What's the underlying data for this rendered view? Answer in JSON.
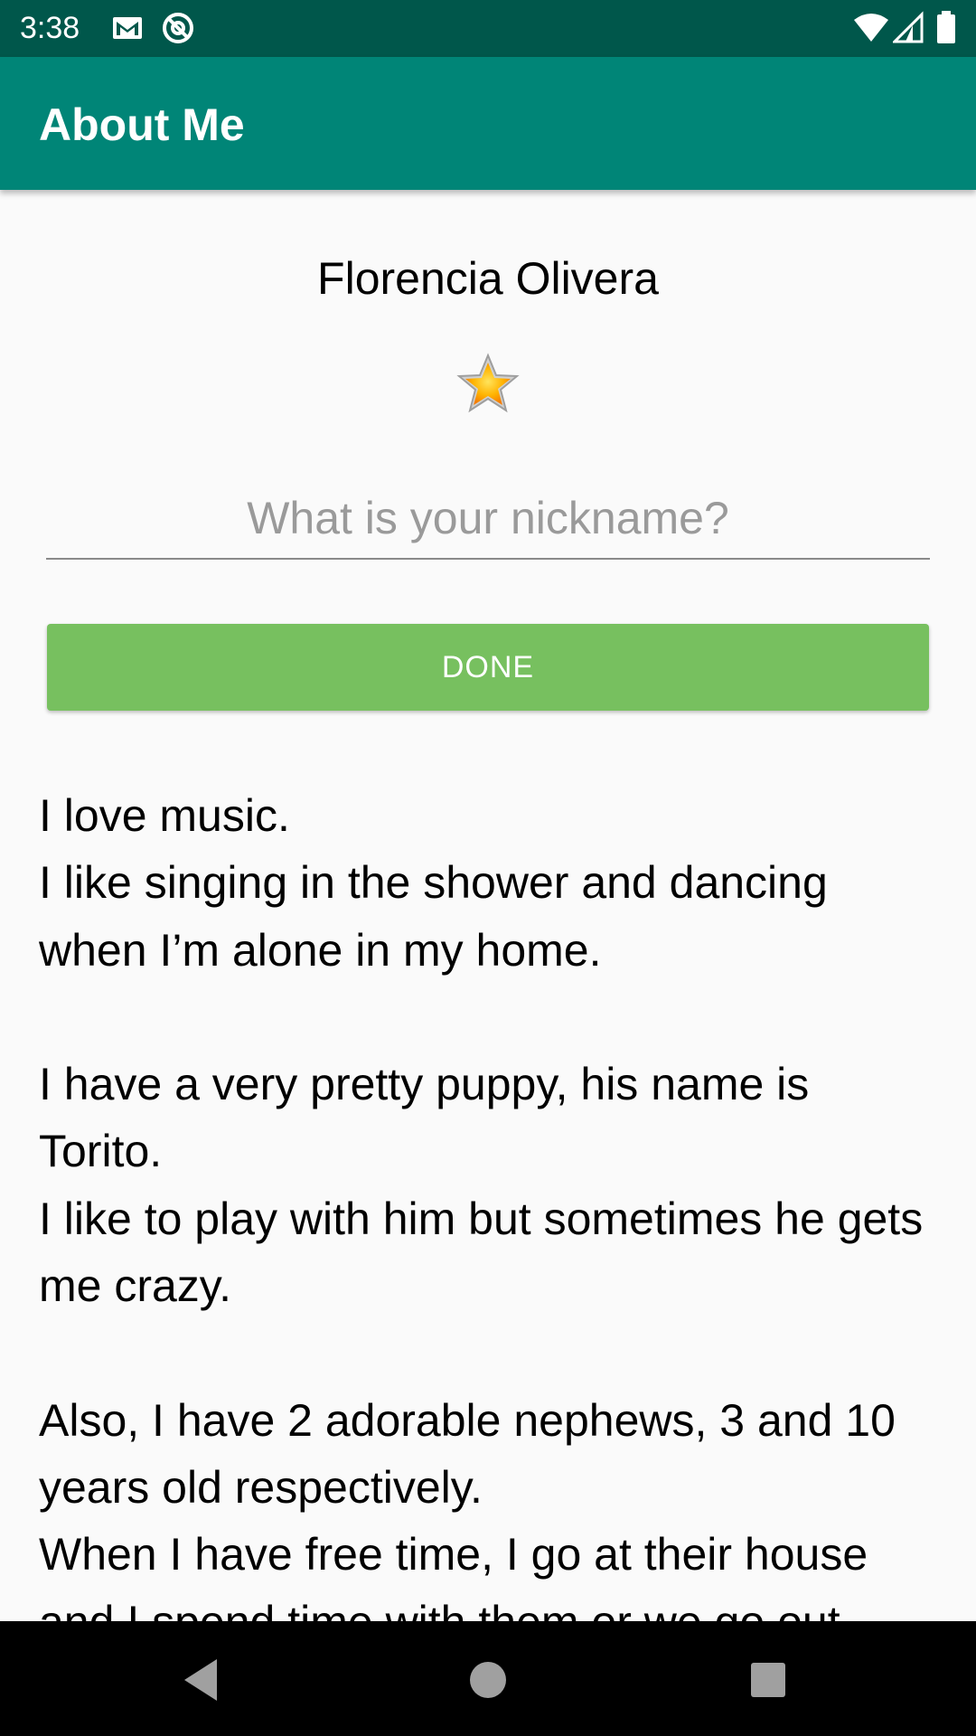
{
  "status_bar": {
    "time": "3:38",
    "icons": [
      "gmail-icon",
      "at-sign-icon",
      "wifi-icon",
      "signal-icon",
      "battery-icon"
    ]
  },
  "app_bar": {
    "title": "About Me",
    "color": "#008577"
  },
  "profile": {
    "name": "Florencia Olivera",
    "star_icon": "star-icon"
  },
  "nickname": {
    "placeholder": "What is your nickname?",
    "value": ""
  },
  "done_button": {
    "label": "DONE",
    "color": "#77C05F"
  },
  "bio": {
    "text": "I love music.\nI like singing in the shower and dancing when I’m alone in my home.\n\nI have a very pretty puppy, his name is Torito.\nI like to play with him but sometimes he gets me crazy.\n\nAlso, I have 2 adorable nephews, 3 and 10 years old respectively.\nWhen I have free time, I go at their house and I spend time with them or we go out"
  },
  "nav_bar": {
    "icons": [
      "back-icon",
      "home-icon",
      "recents-icon"
    ]
  }
}
